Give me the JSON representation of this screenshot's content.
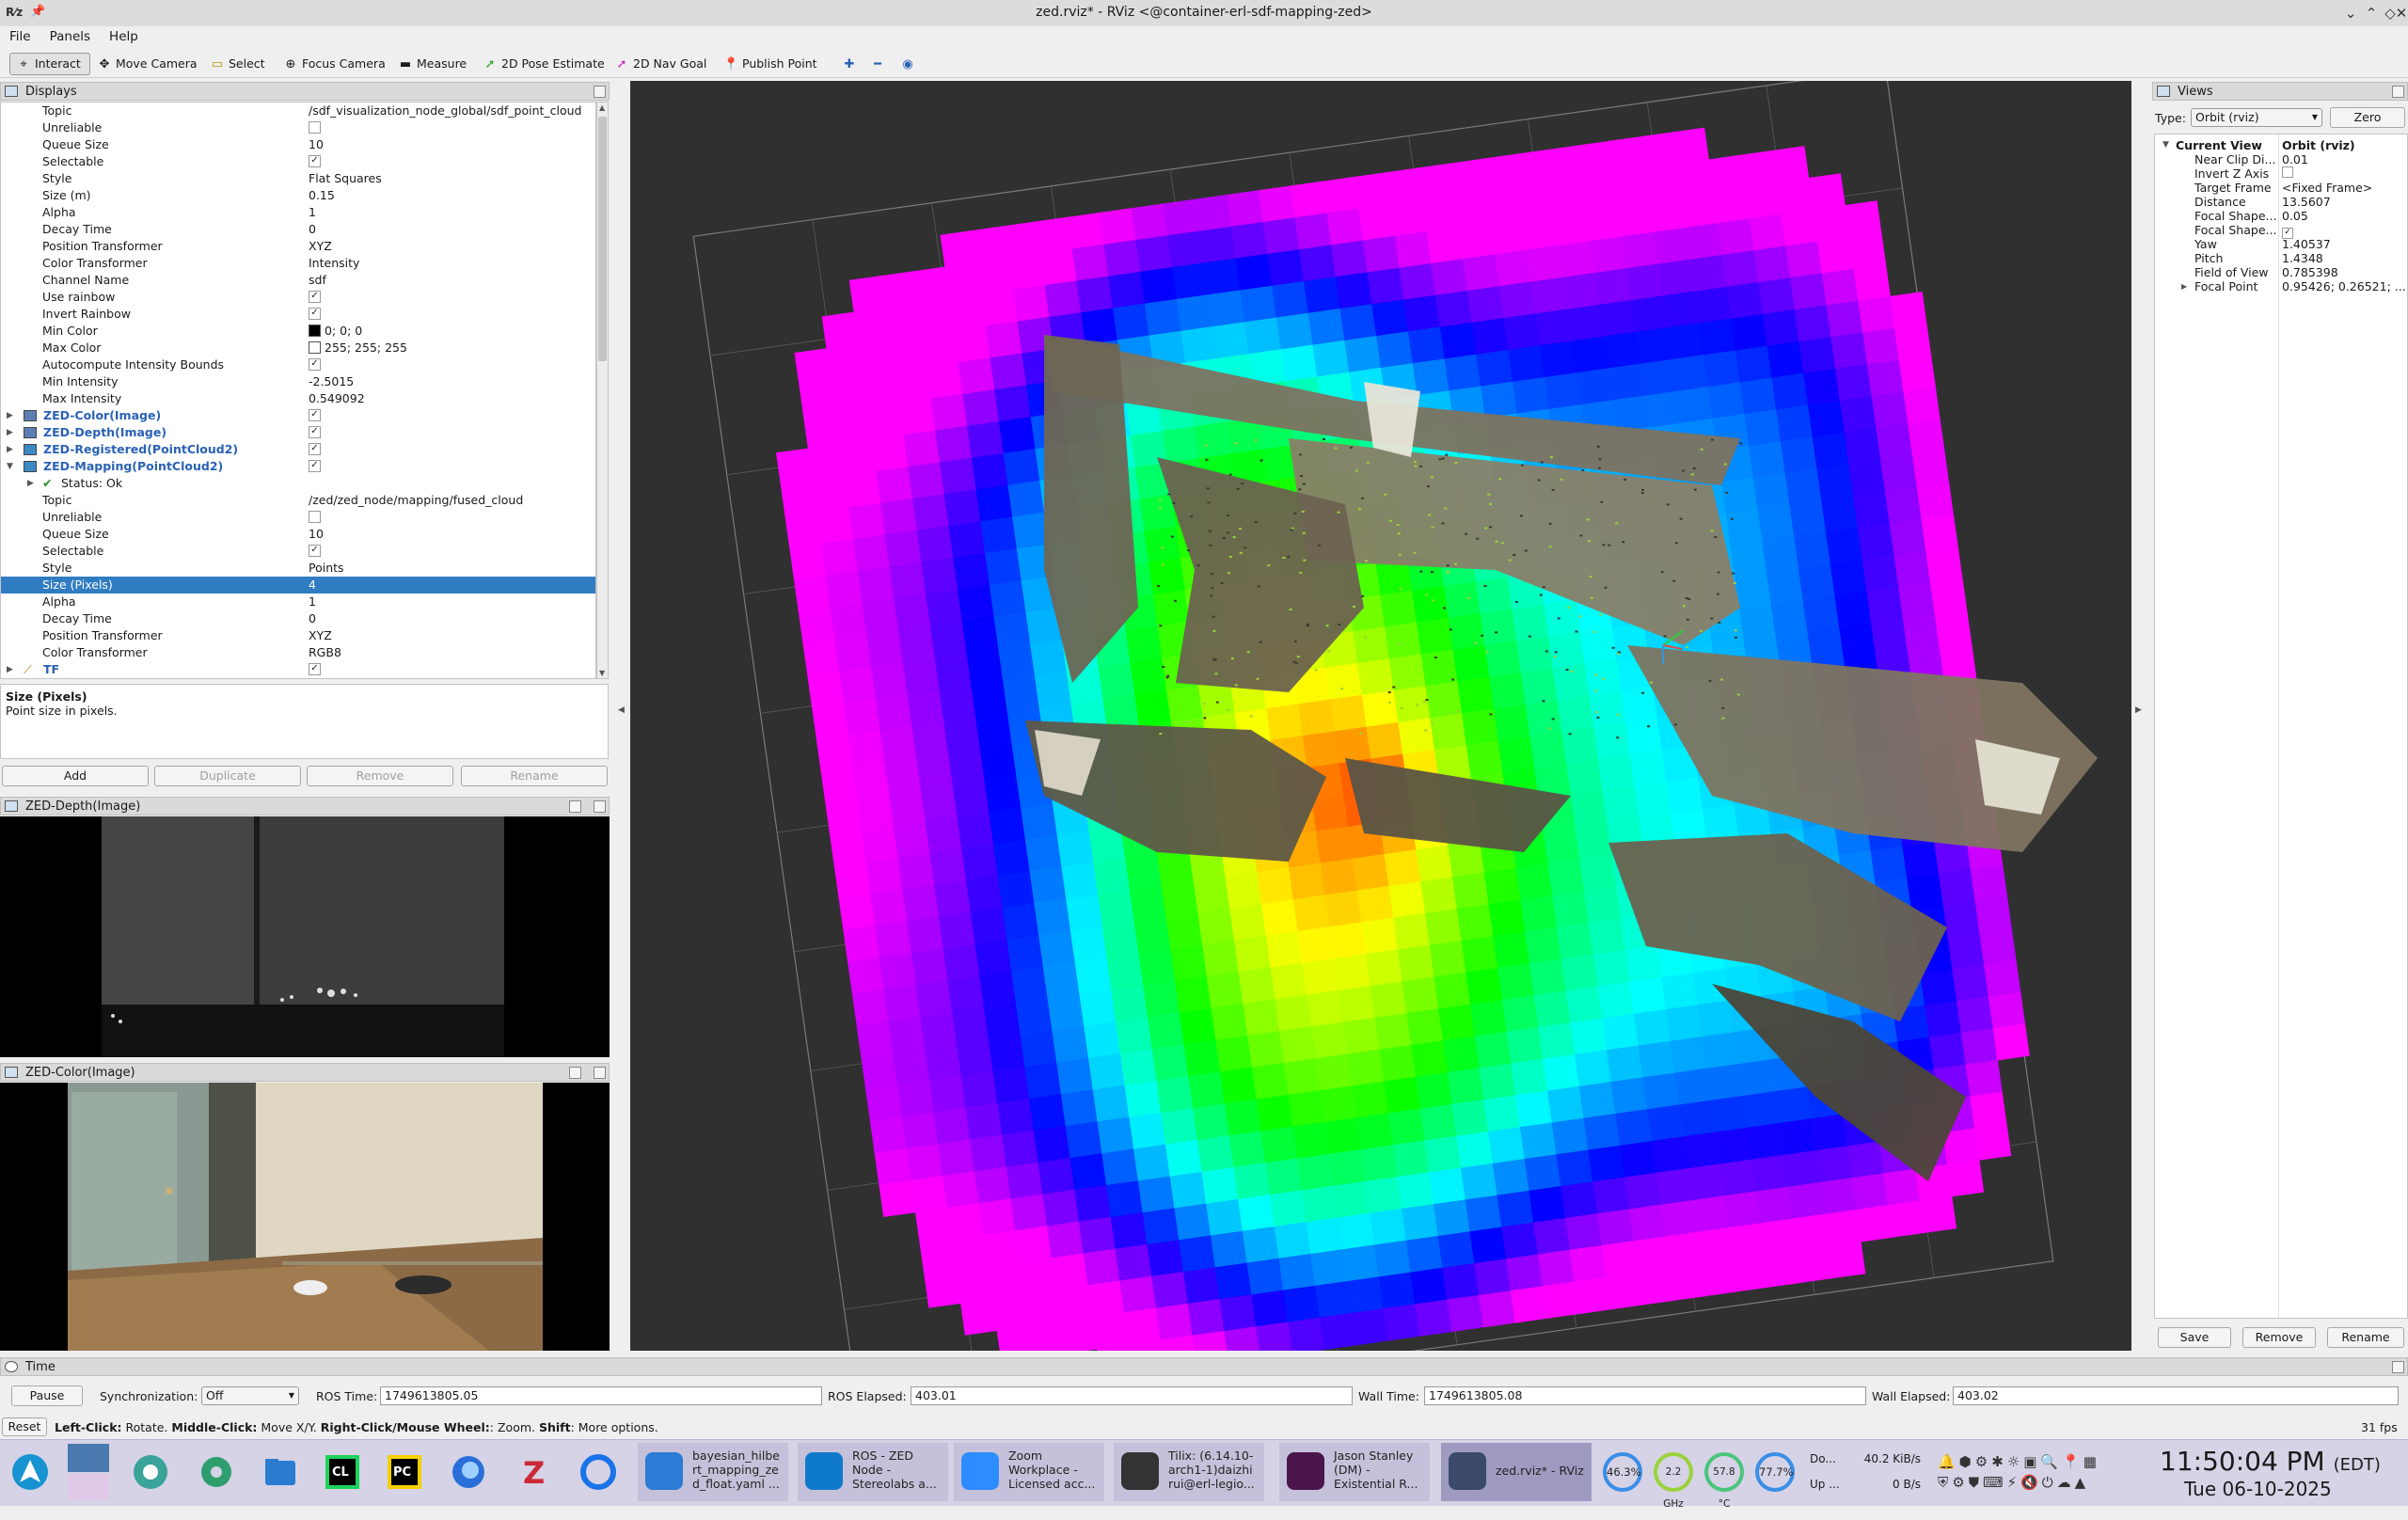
{
  "window": {
    "title": "zed.rviz* - RViz <@container-erl-sdf-mapping-zed>"
  },
  "menu": [
    "File",
    "Panels",
    "Help"
  ],
  "toolbar": {
    "tools": [
      "Interact",
      "Move Camera",
      "Select",
      "Focus Camera",
      "Measure",
      "2D Pose Estimate",
      "2D Nav Goal",
      "Publish Point"
    ]
  },
  "displays": {
    "title": "Displays",
    "rows": [
      {
        "key": "Topic",
        "value": "/sdf_visualization_node_global/sdf_point_cloud"
      },
      {
        "key": "Unreliable",
        "value": ""
      },
      {
        "key": "Queue Size",
        "value": "10"
      },
      {
        "key": "Selectable",
        "value": "✓"
      },
      {
        "key": "Style",
        "value": "Flat Squares"
      },
      {
        "key": "Size (m)",
        "value": "0.15"
      },
      {
        "key": "Alpha",
        "value": "1"
      },
      {
        "key": "Decay Time",
        "value": "0"
      },
      {
        "key": "Position Transformer",
        "value": "XYZ"
      },
      {
        "key": "Color Transformer",
        "value": "Intensity"
      },
      {
        "key": "Channel Name",
        "value": "sdf"
      },
      {
        "key": "Use rainbow",
        "value": "✓"
      },
      {
        "key": "Invert Rainbow",
        "value": "✓"
      },
      {
        "key": "Min Color",
        "value": "0; 0; 0"
      },
      {
        "key": "Max Color",
        "value": "255; 255; 255"
      },
      {
        "key": "Autocompute Intensity Bounds",
        "value": "✓"
      },
      {
        "key": "Min Intensity",
        "value": "-2.5015"
      },
      {
        "key": "Max Intensity",
        "value": "0.549092"
      }
    ],
    "groups": [
      {
        "label": "ZED-Color(Image)",
        "check": "✓"
      },
      {
        "label": "ZED-Depth(Image)",
        "check": "✓"
      },
      {
        "label": "ZED-Registered(PointCloud2)",
        "check": "✓"
      },
      {
        "label": "ZED-Mapping(PointCloud2)",
        "check": "✓"
      }
    ],
    "status": "Status: Ok",
    "rows2": [
      {
        "key": "Topic",
        "value": "/zed/zed_node/mapping/fused_cloud"
      },
      {
        "key": "Unreliable",
        "value": ""
      },
      {
        "key": "Queue Size",
        "value": "10"
      },
      {
        "key": "Selectable",
        "value": "✓"
      },
      {
        "key": "Style",
        "value": "Points"
      },
      {
        "key": "Size (Pixels)",
        "value": "4"
      },
      {
        "key": "Alpha",
        "value": "1"
      },
      {
        "key": "Decay Time",
        "value": "0"
      },
      {
        "key": "Position Transformer",
        "value": "XYZ"
      },
      {
        "key": "Color Transformer",
        "value": "RGB8"
      }
    ],
    "tf_label": "TF",
    "tf_check": "✓",
    "desc_title": "Size (Pixels)",
    "desc_text": "Point size in pixels.",
    "buttons": {
      "add": "Add",
      "duplicate": "Duplicate",
      "remove": "Remove",
      "rename": "Rename"
    }
  },
  "depth_panel": {
    "title": "ZED-Depth(Image)"
  },
  "color_panel": {
    "title": "ZED-Color(Image)"
  },
  "views": {
    "title": "Views",
    "type_label": "Type:",
    "type_value": "Orbit (rviz)",
    "zero": "Zero",
    "current_view": "Current View",
    "current_view_value": "Orbit (rviz)",
    "rows": [
      {
        "key": "Near Clip Di...",
        "value": "0.01"
      },
      {
        "key": "Invert Z Axis",
        "value": ""
      },
      {
        "key": "Target Frame",
        "value": "<Fixed Frame>"
      },
      {
        "key": "Distance",
        "value": "13.5607"
      },
      {
        "key": "Focal Shape...",
        "value": "0.05"
      },
      {
        "key": "Focal Shape...",
        "value": "✓"
      },
      {
        "key": "Yaw",
        "value": "1.40537"
      },
      {
        "key": "Pitch",
        "value": "1.4348"
      },
      {
        "key": "Field of View",
        "value": "0.785398"
      },
      {
        "key": "Focal Point",
        "value": "0.95426; 0.26521; ..."
      }
    ],
    "buttons": {
      "save": "Save",
      "remove": "Remove",
      "rename": "Rename"
    }
  },
  "time": {
    "title": "Time",
    "pause": "Pause",
    "sync_label": "Synchronization:",
    "sync_value": "Off",
    "ros_time_label": "ROS Time:",
    "ros_time": "1749613805.05",
    "ros_elapsed_label": "ROS Elapsed:",
    "ros_elapsed": "403.01",
    "wall_time_label": "Wall Time:",
    "wall_time": "1749613805.08",
    "wall_elapsed_label": "Wall Elapsed:",
    "wall_elapsed": "403.02"
  },
  "statusbar": {
    "reset": "Reset",
    "hint_b1": "Left-Click:",
    "hint_t1": " Rotate. ",
    "hint_b2": "Middle-Click:",
    "hint_t2": " Move X/Y. ",
    "hint_b3": "Right-Click/Mouse Wheel:",
    "hint_t3": ": Zoom. ",
    "hint_b4": "Shift",
    "hint_t4": ": More options.",
    "fps": "31 fps"
  },
  "taskbar": {
    "windows": [
      {
        "text": "bayesian_hilbe\nrt_mapping_ze\nd_float.yaml ..."
      },
      {
        "text": "ROS - ZED\nNode -\nStereolabs a..."
      },
      {
        "text": "Zoom\nWorkplace -\nLicensed acc..."
      },
      {
        "text": "Tilix: (6.14.10-\narch1-1)daizhi\nrui@erl-legio..."
      },
      {
        "text": "Jason Stanley\n(DM) -\nExistential R..."
      },
      {
        "text": "zed.rviz* - RViz"
      }
    ],
    "meters": [
      "46.3%",
      "2.2 GHz",
      "57.8 °C",
      "77.7%"
    ],
    "net": {
      "down_label": "Do...",
      "up_label": "Up ...",
      "down": "40.2 KiB/s",
      "up": "0 B/s"
    },
    "clock": "11:50:04 PM",
    "tz": "(EDT)",
    "date": "Tue 06-10-2025"
  },
  "colors": {
    "selection": "#2f7cc2",
    "link_blue": "#2a62b5",
    "viewport_bg": "#303030"
  }
}
